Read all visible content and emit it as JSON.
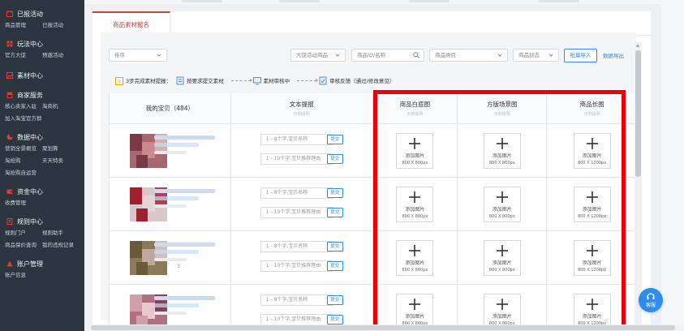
{
  "sidebar": {
    "groups": [
      {
        "title": "已报活动",
        "icon": "calendar-icon",
        "items": [
          "商品管理",
          "已报活动"
        ]
      },
      {
        "title": "玩法中心",
        "icon": "grid-icon",
        "items": [
          "官方大促",
          "预邀活动"
        ]
      },
      {
        "title": "素材中心",
        "icon": "image-icon",
        "items": []
      },
      {
        "title": "商家服务",
        "icon": "shop-icon",
        "items": [
          "核心卖家入驻",
          "淘商机",
          "加入淘宝官方群"
        ]
      },
      {
        "title": "数据中心",
        "icon": "chart-icon",
        "items": [
          "营销全景概览",
          "聚划算",
          "淘抢购",
          "天天特卖",
          "淘抢购自运营"
        ]
      },
      {
        "title": "资金中心",
        "icon": "wallet-icon",
        "items": [
          "收费管理"
        ]
      },
      {
        "title": "规则中心",
        "icon": "rules-icon",
        "items": [
          "规则门户",
          "规则助手",
          "商品保价查询",
          "我的违规记录"
        ]
      },
      {
        "title": "账户管理",
        "icon": "user-icon",
        "items": [
          "账户信息"
        ]
      }
    ]
  },
  "tab": {
    "label": "商品素材报名"
  },
  "filters": {
    "sort": "排序",
    "big_promo": "大促活动商品",
    "search_placeholder": "商品ID/名称",
    "category": "商品类目",
    "status": "商品状态",
    "import_btn": "批量导入",
    "export_link": "数据导出"
  },
  "steps": {
    "intro": "3步完成素材提报：",
    "step1": "按要求提交素材",
    "step2": "素材审核中",
    "step3": "审核反馈（通过/修改意见）"
  },
  "table": {
    "headers": [
      {
        "label": "我的宝贝（484）",
        "sub": ""
      },
      {
        "label": "文本提报",
        "sub": "示例说明"
      },
      {
        "label": "商品白底图",
        "sub": "示例说明"
      },
      {
        "label": "方版场景图",
        "sub": "示例说明"
      },
      {
        "label": "商品长图",
        "sub": "示例说明"
      }
    ],
    "name_placeholder": "1 - 8个字,宝贝名称",
    "reason_placeholder": "1 - 10个字,宝贝推荐理由",
    "submit": "提交",
    "upload_label": "添加图片",
    "size_square": "800 X 800px",
    "size_long": "800 X 1200px",
    "rows": [
      {
        "tag": ""
      },
      {
        "tag": ""
      },
      {
        "tag": "3"
      },
      {
        "tag": ""
      }
    ]
  },
  "kefu": {
    "label": "客服"
  },
  "colors": {
    "accent": "#e5392c",
    "link": "#2d8cf0",
    "highlight": "#e8000b",
    "sidebar": "#2c3440"
  }
}
